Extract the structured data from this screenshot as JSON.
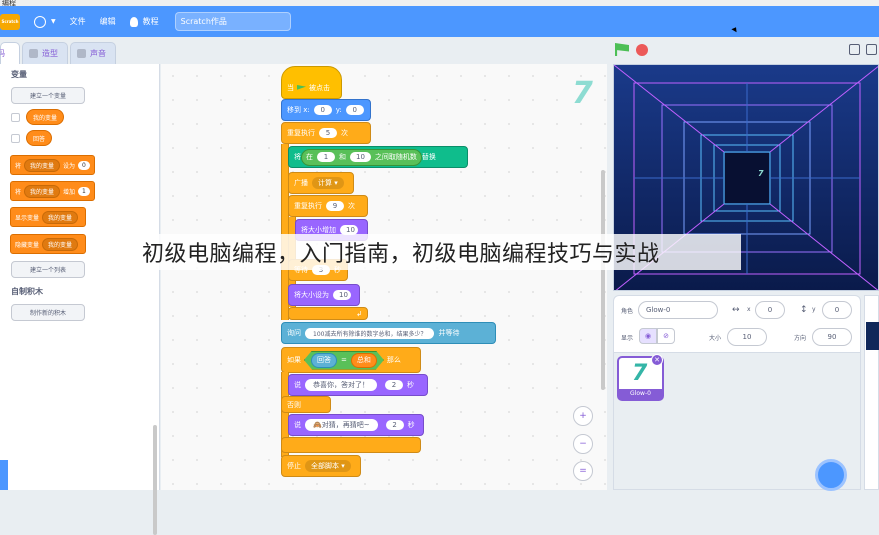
{
  "window": {
    "title": "编程"
  },
  "menubar": {
    "logo": "Scratch",
    "items": [
      {
        "label": "",
        "icon": "globe-icon"
      },
      {
        "label": "文件"
      },
      {
        "label": "编辑"
      },
      {
        "label": "教程",
        "icon": "lightbulb-icon"
      }
    ],
    "project_title": "Scratch作品"
  },
  "tabs": [
    {
      "label": "代码"
    },
    {
      "label": "造型"
    },
    {
      "label": "声音"
    }
  ],
  "palette": {
    "category": "变量",
    "make_variable": "建立一个变量",
    "variables": [
      "我的变量",
      "回答"
    ],
    "set_block": {
      "label": "将",
      "var": "我的变量",
      "op": "设为",
      "value": "0"
    },
    "change_block": {
      "label": "将",
      "var": "我的变量",
      "op": "增加",
      "value": "1"
    },
    "show_block": {
      "label": "显示变量",
      "var": "我的变量"
    },
    "hide_block": {
      "label": "隐藏变量",
      "var": "我的变量"
    },
    "make_list": "建立一个列表",
    "my_blocks_title": "自制积木",
    "make_block": "制作新的积木"
  },
  "scripts": {
    "hat": {
      "prefix": "当",
      "suffix": "被点击",
      "icon": "green-flag-icon"
    },
    "goto": {
      "label": "移到 x:",
      "x": "0",
      "ylabel": "y:",
      "y": "0"
    },
    "repeat1": {
      "label": "重复执行",
      "times": "5",
      "suffix": "次"
    },
    "erase": {
      "label": "将",
      "op": "在",
      "from": "1",
      "and": "和",
      "to": "10",
      "rand": "之间取随机数",
      "suffix": "替换"
    },
    "broadcast": {
      "label": "广播",
      "msg": "计算"
    },
    "repeat2": {
      "label": "重复执行",
      "times": "9",
      "suffix": "次"
    },
    "grow": {
      "label": "将大小增加",
      "value": "10"
    },
    "wait": {
      "label": "等待",
      "value": "3",
      "suffix": "秒"
    },
    "setsize": {
      "label": "将大小设为",
      "value": "10"
    },
    "ask": {
      "label": "询问",
      "question": "100减去所有除谁的数字总和，结果多少？",
      "suffix": "并等待"
    },
    "if": {
      "label": "如果",
      "left": "回答",
      "op": "=",
      "right": "总和",
      "suffix": "那么"
    },
    "say1": {
      "label": "说",
      "text": "恭喜你，答对了！",
      "secs": "2",
      "suffix": "秒"
    },
    "else": {
      "label": "否则"
    },
    "say2": {
      "label": "说",
      "text": "🙈对猜，再猜吧~",
      "secs": "2",
      "suffix": "秒"
    },
    "stop": {
      "label": "停止",
      "opt": "全部脚本"
    }
  },
  "zoom": {
    "in": "+",
    "out": "−",
    "reset": "="
  },
  "sprite_info": {
    "sprite_label": "角色",
    "sprite_name": "Glow-0",
    "x_label": "x",
    "x": "0",
    "y_label": "y",
    "y": "0",
    "show_label": "显示",
    "size_label": "大小",
    "size": "10",
    "direction_label": "方向",
    "direction": "90"
  },
  "sprites": [
    {
      "name": "Glow-0",
      "glyph": "7"
    }
  ],
  "stage_center_glyph": "7",
  "watermark": "初级电脑编程，入门指南，初级电脑编程技巧与实战",
  "colors": {
    "menubar": "#4c97ff",
    "motion": "#4c97ff",
    "control": "#ffab19",
    "looks": "#9966ff",
    "sensing": "#5cb1d6",
    "operators": "#59c059",
    "variables": "#ff8c1a"
  }
}
